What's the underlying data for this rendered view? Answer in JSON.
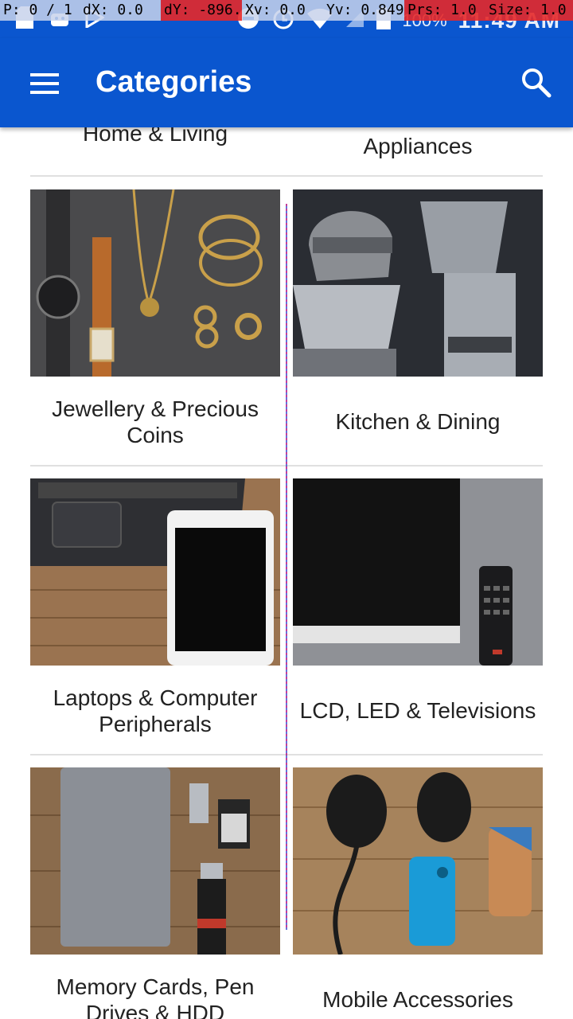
{
  "overlay": {
    "p": "P: 0 / 1",
    "dx": "dX: 0.0",
    "dy": "dY: -896.0",
    "xv": "Xv: 0.0",
    "yv": "Yv: 0.849",
    "prs": "Prs: 1.0",
    "size": "Size: 1.0"
  },
  "status_bar": {
    "battery_percent": "100%",
    "time": "11:49 AM"
  },
  "app_bar": {
    "title": "Categories"
  },
  "categories": {
    "partial_top": [
      {
        "label": "Home & Living"
      },
      {
        "label": "Appliances"
      }
    ],
    "items": [
      {
        "label": "Jewellery & Precious Coins"
      },
      {
        "label": "Kitchen & Dining"
      },
      {
        "label": "Laptops & Computer Peripherals"
      },
      {
        "label": "LCD, LED & Televisions"
      },
      {
        "label": "Memory Cards, Pen Drives & HDD"
      },
      {
        "label": "Mobile Accessories"
      }
    ]
  },
  "colors": {
    "primary": "#0a56cf",
    "divider": "#e0e0e0",
    "text": "#222222"
  }
}
